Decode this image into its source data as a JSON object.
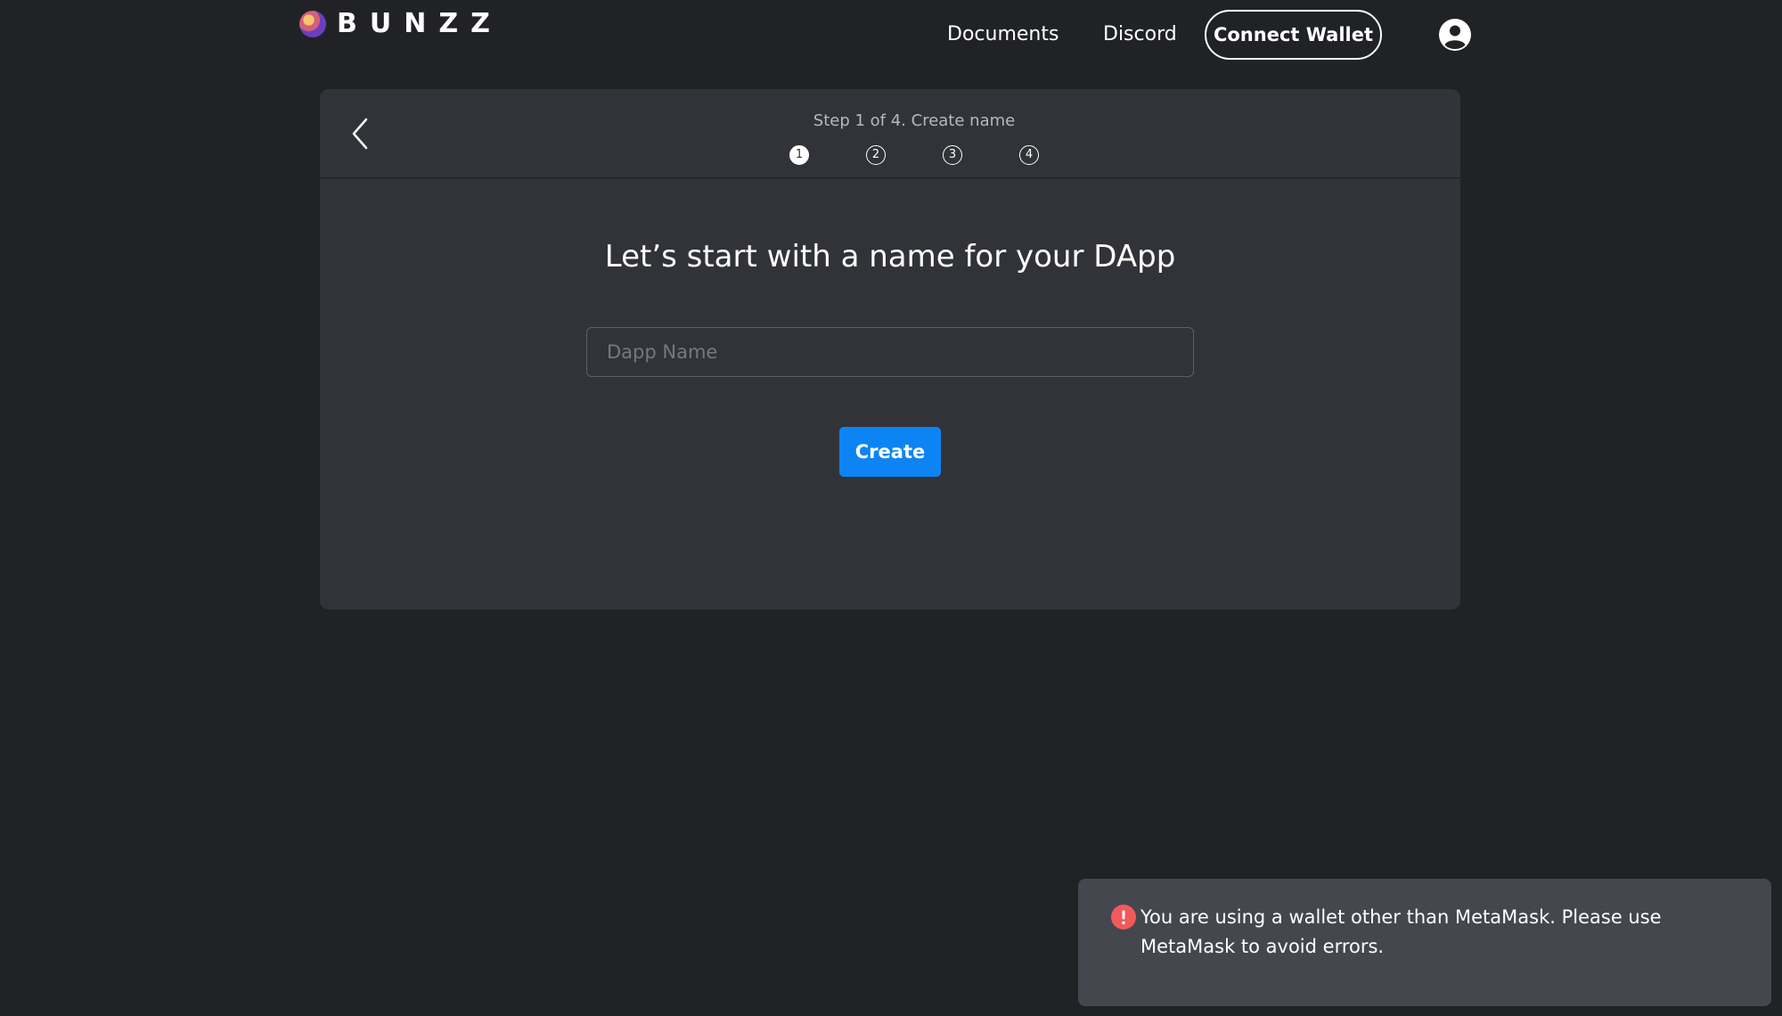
{
  "header": {
    "brand": "BUNZZ",
    "nav": {
      "documents": "Documents",
      "discord": "Discord"
    },
    "connect_wallet": "Connect Wallet",
    "avatar_icon": "user-circle-icon"
  },
  "wizard": {
    "step_label": "Step 1 of 4. Create name",
    "steps": [
      "1",
      "2",
      "3",
      "4"
    ],
    "current_step": 1,
    "back_icon": "chevron-left-icon",
    "title": "Let’s start with a name for your DApp",
    "input": {
      "placeholder": "Dapp Name",
      "value": ""
    },
    "create_label": "Create"
  },
  "toast": {
    "icon": "error-icon",
    "message": "You are using a wallet other than MetaMask. Please use MetaMask to avoid errors.",
    "color": "#f05a5b"
  },
  "colors": {
    "background": "#212226",
    "card": "#323338",
    "primary": "#0d84f4",
    "toast_bg": "#45474e"
  }
}
